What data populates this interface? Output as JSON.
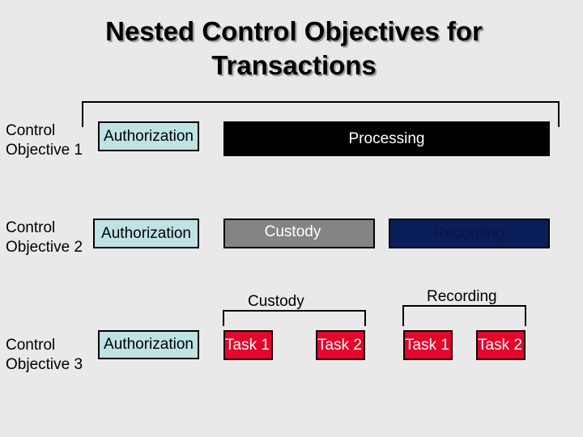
{
  "title": {
    "line1": "Nested Control Objectives for",
    "line2": "Transactions"
  },
  "rows": [
    {
      "label_line1": "Control",
      "label_line2": "Objective 1",
      "authorization": "Authorization",
      "processing": "Processing"
    },
    {
      "label_line1": "Control",
      "label_line2": "Objective 2",
      "authorization": "Authorization",
      "custody": "Custody",
      "recording": "Recording"
    },
    {
      "label_line1": "Control",
      "label_line2": "Objective 3",
      "authorization": "Authorization",
      "custody_group_label": "Custody",
      "recording_group_label": "Recording",
      "custody_tasks": [
        "Task 1",
        "Task 2"
      ],
      "recording_tasks": [
        "Task 1",
        "Task 2"
      ]
    }
  ],
  "colors": {
    "background": "#e9e9e9",
    "authorization": "#bfe2e4",
    "processing": "#000000",
    "custody": "#848484",
    "recording": "#0a1e5a",
    "task": "#e4062b"
  }
}
